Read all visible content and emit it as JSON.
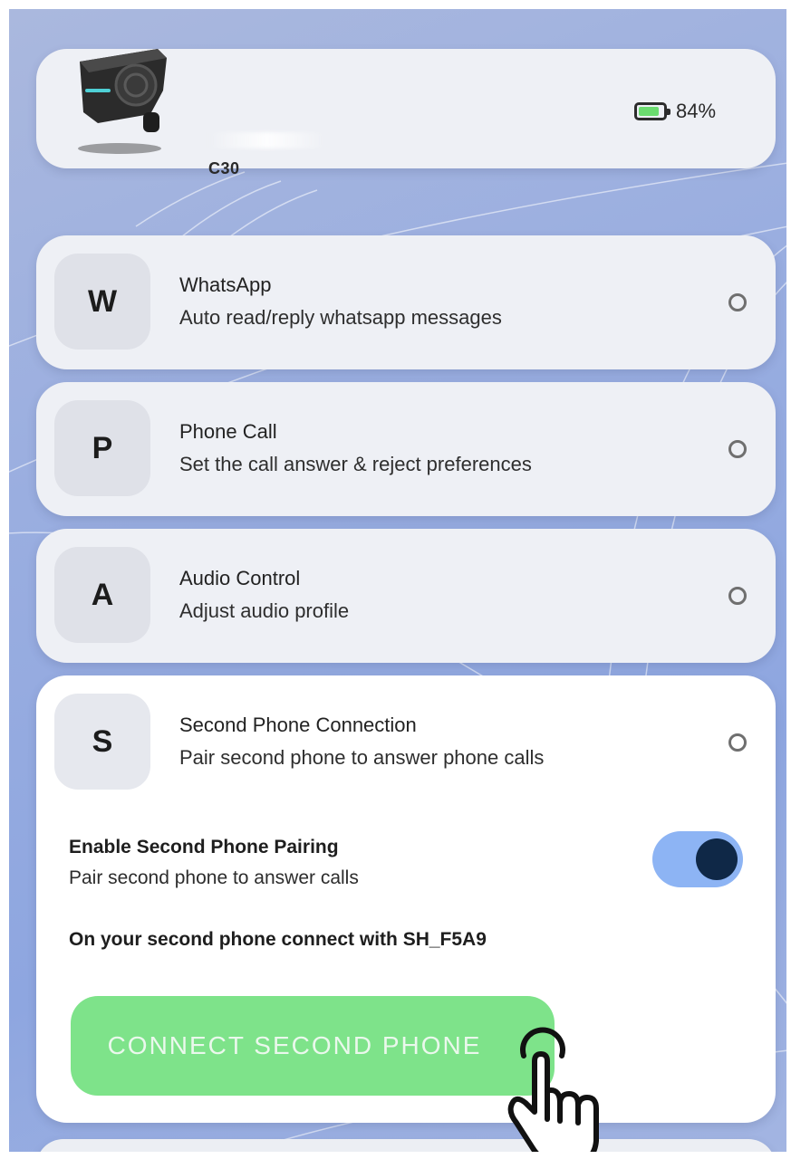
{
  "device": {
    "model": "C30",
    "battery_percent": 84,
    "battery_label": "84%",
    "battery_color": "#6bdc6f"
  },
  "features": [
    {
      "letter": "W",
      "title": "WhatsApp",
      "description": "Auto read/reply whatsapp messages"
    },
    {
      "letter": "P",
      "title": "Phone Call",
      "description": "Set the call answer & reject preferences"
    },
    {
      "letter": "A",
      "title": "Audio Control",
      "description": "Adjust audio profile"
    },
    {
      "letter": "S",
      "title": "Second Phone Connection",
      "description": "Pair second phone to answer phone calls"
    }
  ],
  "second_phone": {
    "enable_title": "Enable Second Phone Pairing",
    "enable_description": "Pair second phone to answer calls",
    "enabled": true,
    "connect_info": "On your second phone connect with SH_F5A9",
    "connect_button_label": "CONNECT SECOND PHONE"
  },
  "colors": {
    "toggle_track": "#8db4f4",
    "toggle_knob": "#0f2847",
    "connect_button": "#7ee38a",
    "background": "#9aaee0"
  },
  "icons": {
    "device": "headset-device-icon",
    "battery": "battery-icon",
    "radio": "radio-button-icon",
    "cursor": "hand-pointer-icon"
  }
}
